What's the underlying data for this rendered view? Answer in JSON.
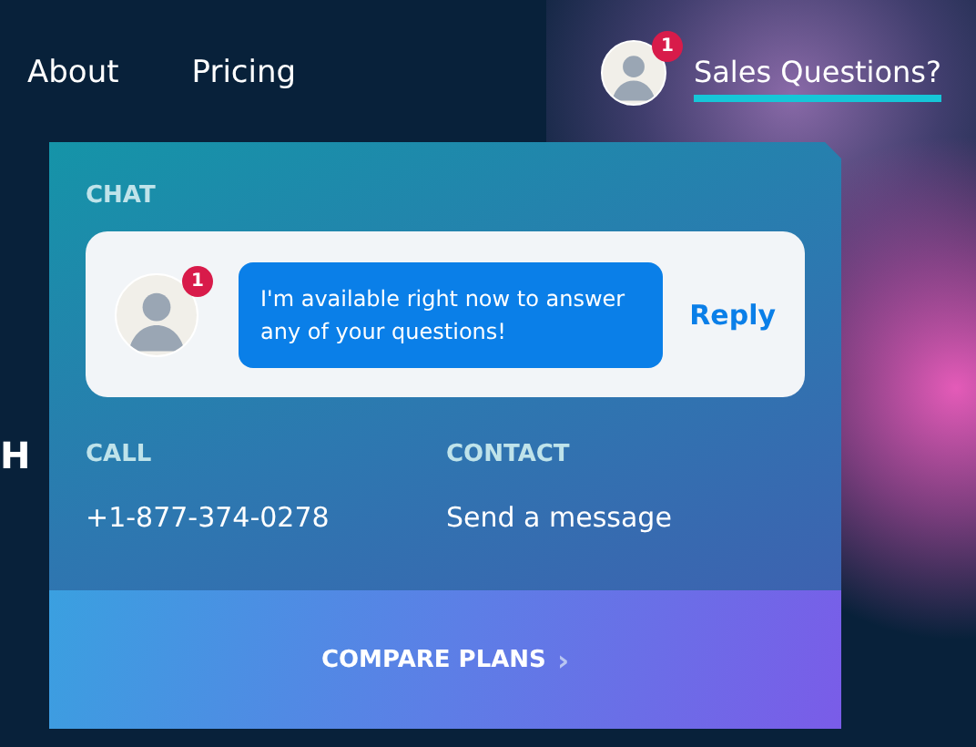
{
  "nav": {
    "links": [
      {
        "label": "About"
      },
      {
        "label": "Pricing"
      }
    ],
    "sales": {
      "label": "Sales Questions?",
      "badge": "1",
      "selected": true
    }
  },
  "hero": {
    "eyebrow": "H"
  },
  "popup": {
    "chat": {
      "heading": "CHAT",
      "badge": "1",
      "message": "I'm available right now to answer any of your questions!",
      "reply": "Reply"
    },
    "contacts": [
      {
        "heading": "CALL",
        "value": "+1-877-374-0278"
      },
      {
        "heading": "CONTACT",
        "value": "Send a message"
      }
    ],
    "footer": {
      "label": "COMPARE PLANS",
      "arrow": "›"
    }
  }
}
